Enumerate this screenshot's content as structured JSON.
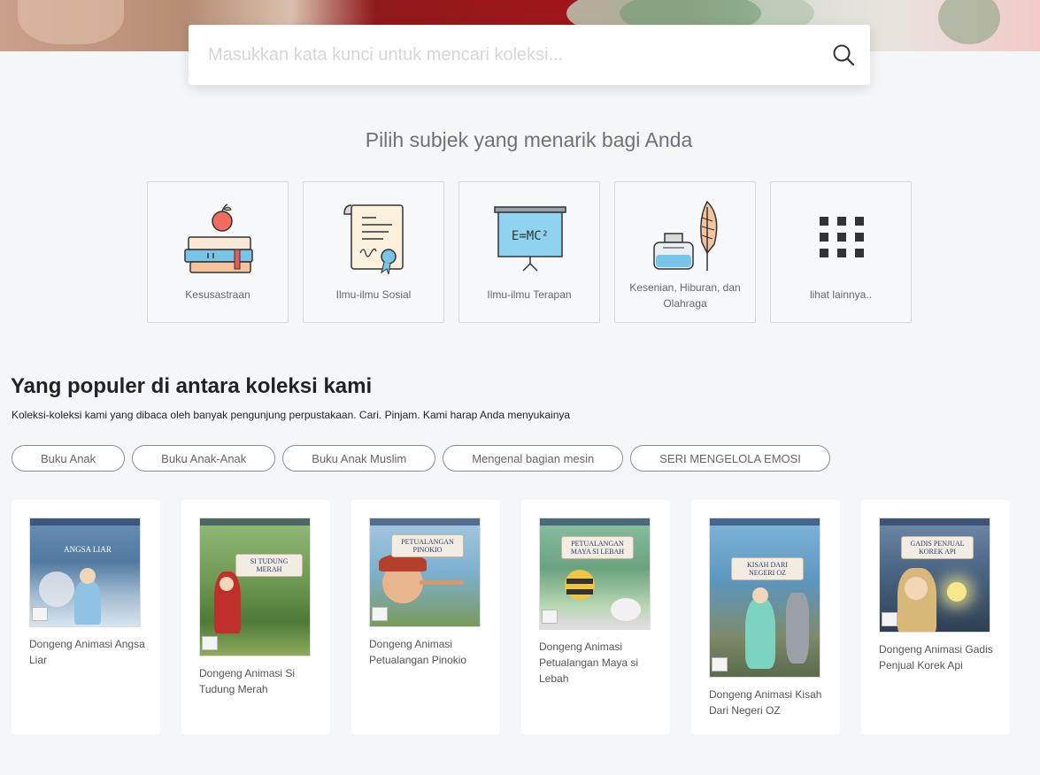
{
  "search": {
    "placeholder": "Masukkan kata kunci untuk mencari koleksi..."
  },
  "subjects": {
    "heading": "Pilih subjek yang menarik bagi Anda",
    "items": [
      {
        "label": "Kesusastraan",
        "icon": "books-apple-icon"
      },
      {
        "label": "Ilmu-ilmu Sosial",
        "icon": "certificate-scroll-icon"
      },
      {
        "label": "Ilmu-ilmu Terapan",
        "icon": "presentation-board-icon"
      },
      {
        "label": "Kesenian, Hiburan, dan Olahraga",
        "icon": "ink-quill-icon"
      },
      {
        "label": "lihat lainnya..",
        "icon": "grid-dots-icon"
      }
    ],
    "board_formula": "E=MC²"
  },
  "popular": {
    "title": "Yang populer di antara koleksi kami",
    "description": "Koleksi-koleksi kami yang dibaca oleh banyak pengunjung perpustakaan. Cari. Pinjam. Kami harap Anda menyukainya",
    "tags": [
      "Buku Anak",
      "Buku Anak-Anak",
      "Buku Anak Muslim",
      "Mengenal bagian mesin",
      "SERI MENGELOLA EMOSI"
    ],
    "books": [
      {
        "title": "Dongeng Animasi Angsa Liar",
        "cover_text": "Angsa Liar"
      },
      {
        "title": "Dongeng Animasi Si Tudung Merah",
        "cover_text": "Si Tudung Merah"
      },
      {
        "title": "Dongeng Animasi Petualangan Pinokio",
        "cover_text": "Petualangan Pinokio"
      },
      {
        "title": "Dongeng Animasi Petualangan Maya si Lebah",
        "cover_text": "Petualangan Maya si Lebah"
      },
      {
        "title": "Dongeng Animasi Kisah Dari Negeri OZ",
        "cover_text": "Kisah dari Negeri Oz"
      },
      {
        "title": "Dongeng Animasi Gadis Penjual Korek Api",
        "cover_text": "Gadis Penjual Korek Api"
      }
    ]
  },
  "colors": {
    "page_background": "#f5f6f8",
    "card_border": "#d6d8dc",
    "tag_border": "#8a8e93",
    "icon_blue": "#79c5e8",
    "icon_peach": "#f5c49c",
    "icon_dark": "#333333"
  }
}
